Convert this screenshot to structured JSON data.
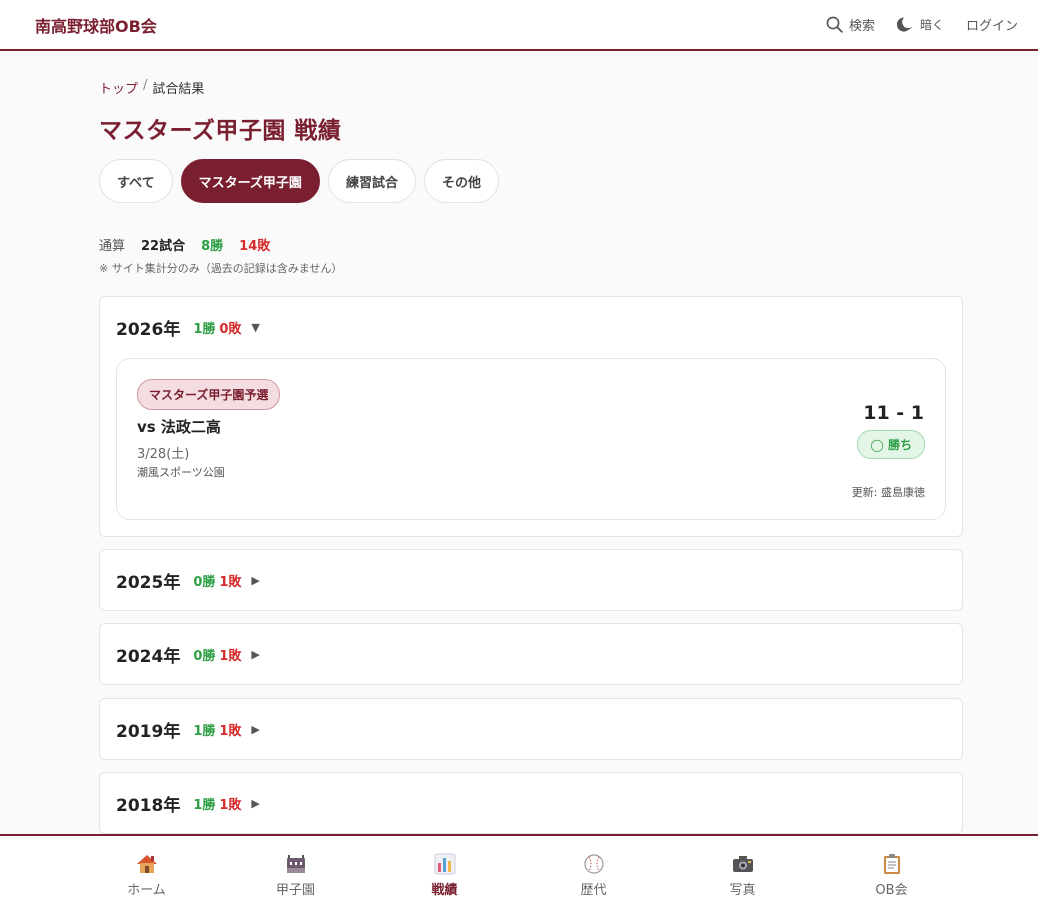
{
  "header": {
    "brand": "南高野球部OB会",
    "search_label": "検索",
    "theme_label": "暗く",
    "login_label": "ログイン"
  },
  "breadcrumb": {
    "home": "トップ",
    "separator": "/",
    "current": "試合結果"
  },
  "page_title": "マスターズ甲子園 戦績",
  "tabs": [
    {
      "label": "すべて",
      "active": false
    },
    {
      "label": "マスターズ甲子園",
      "active": true
    },
    {
      "label": "練習試合",
      "active": false
    },
    {
      "label": "その他",
      "active": false
    }
  ],
  "summary": {
    "label": "通算",
    "games": "22試合",
    "wins": "8勝",
    "losses": "14敗",
    "note": "※ サイト集計分のみ（過去の記録は含みません）"
  },
  "years": [
    {
      "year": "2026年",
      "wins": "1勝",
      "losses": "0敗",
      "caret": "▼",
      "expanded": true,
      "games": [
        {
          "competition": "マスターズ甲子園予選",
          "opponent": "vs 法政二高",
          "date": "3/28(土)",
          "venue": "潮風スポーツ公園",
          "score": "11 - 1",
          "result": "◯ 勝ち",
          "updated": "更新: 盛島康徳"
        }
      ]
    },
    {
      "year": "2025年",
      "wins": "0勝",
      "losses": "1敗",
      "caret": "▶",
      "expanded": false
    },
    {
      "year": "2024年",
      "wins": "0勝",
      "losses": "1敗",
      "caret": "▶",
      "expanded": false
    },
    {
      "year": "2019年",
      "wins": "1勝",
      "losses": "1敗",
      "caret": "▶",
      "expanded": false
    },
    {
      "year": "2018年",
      "wins": "1勝",
      "losses": "1敗",
      "caret": "▶",
      "expanded": false
    }
  ],
  "bottom_nav": [
    {
      "label": "ホーム",
      "icon": "house-icon",
      "active": false
    },
    {
      "label": "甲子園",
      "icon": "stadium-icon",
      "active": false
    },
    {
      "label": "戦績",
      "icon": "bar-chart-icon",
      "active": true
    },
    {
      "label": "歴代",
      "icon": "baseball-icon",
      "active": false
    },
    {
      "label": "写真",
      "icon": "camera-icon",
      "active": false
    },
    {
      "label": "OB会",
      "icon": "clipboard-icon",
      "active": false
    }
  ],
  "colors": {
    "accent": "#7a1f30",
    "win": "#2e9e45",
    "loss": "#d62b2b",
    "background": "#fafafa"
  }
}
